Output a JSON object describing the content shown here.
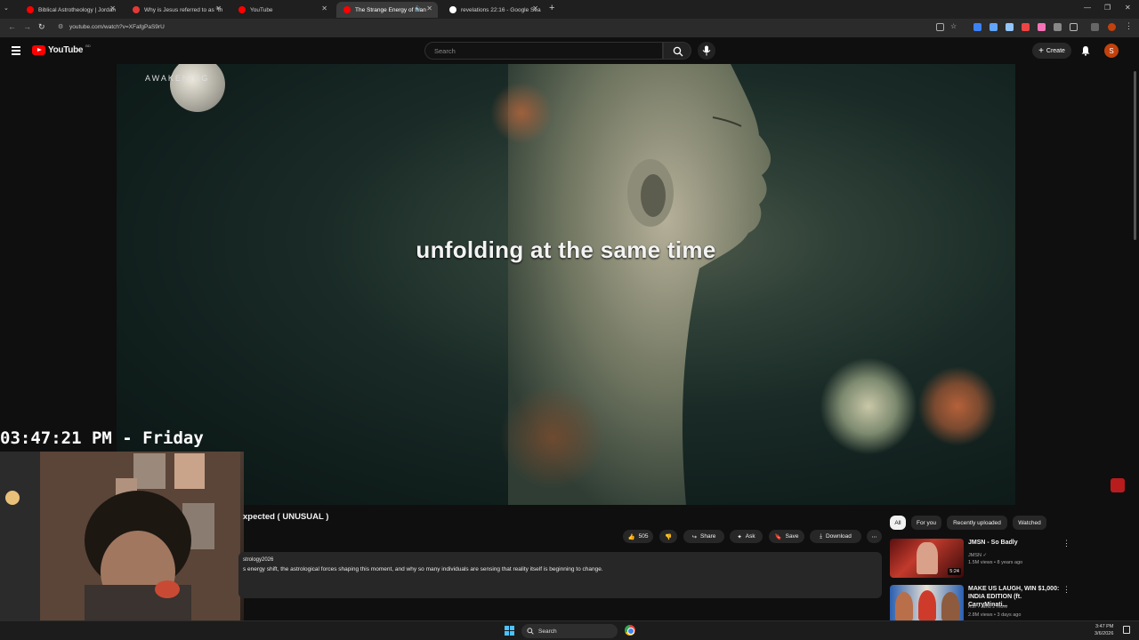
{
  "browser": {
    "tabs": [
      {
        "title": "Biblical Astrotheology | Jordan",
        "icon": "youtube-icon",
        "color": "#ff0000"
      },
      {
        "title": "Why is Jesus referred to as \"th",
        "icon": "site-icon",
        "color": "#e53935"
      },
      {
        "title": "YouTube",
        "icon": "youtube-icon",
        "color": "#ff0000"
      },
      {
        "title": "The Strange Energy of Man",
        "icon": "youtube-icon",
        "color": "#ff0000",
        "active": true
      },
      {
        "title": "revelations 22:16 - Google Sea",
        "icon": "google-icon",
        "color": "#ffffff"
      }
    ],
    "new_tab": "+",
    "url": "youtube.com/watch?v=XFafgPaS9rU"
  },
  "youtube": {
    "logo_text": "YouTube",
    "country_code": "BD",
    "search_placeholder": "Search",
    "create_label": "Create",
    "avatar_letter": "S"
  },
  "video": {
    "caption": "unfolding at the same time",
    "watermark": "AWAKENING"
  },
  "overlay": {
    "clock": "03:47:21 PM - Friday"
  },
  "details": {
    "title": "xpected ( UNUSUAL )",
    "channel": "strology2026",
    "description": "s energy shift, the astrological forces shaping this moment, and why so many individuals are sensing that reality itself is beginning to change.",
    "likes": "505",
    "share": "Share",
    "ask": "Ask",
    "save": "Save",
    "download": "Download"
  },
  "sidebar": {
    "chips": [
      "All",
      "For you",
      "Recently uploaded",
      "Watched"
    ],
    "recs": [
      {
        "title": "JMSN - So Badly",
        "channel": "JMSN",
        "meta": "1.5M views • 8 years ago",
        "duration": "5:24"
      },
      {
        "title": "MAKE US LAUGH, WIN $1,000: INDIA EDITION (ft. CarryMinati...",
        "channel": "KSI",
        "extra": "and 2 more",
        "meta": "2.8M views • 3 days ago"
      }
    ]
  },
  "taskbar": {
    "search_label": "Search",
    "time": "3:47 PM",
    "date": "3/6/2026"
  }
}
